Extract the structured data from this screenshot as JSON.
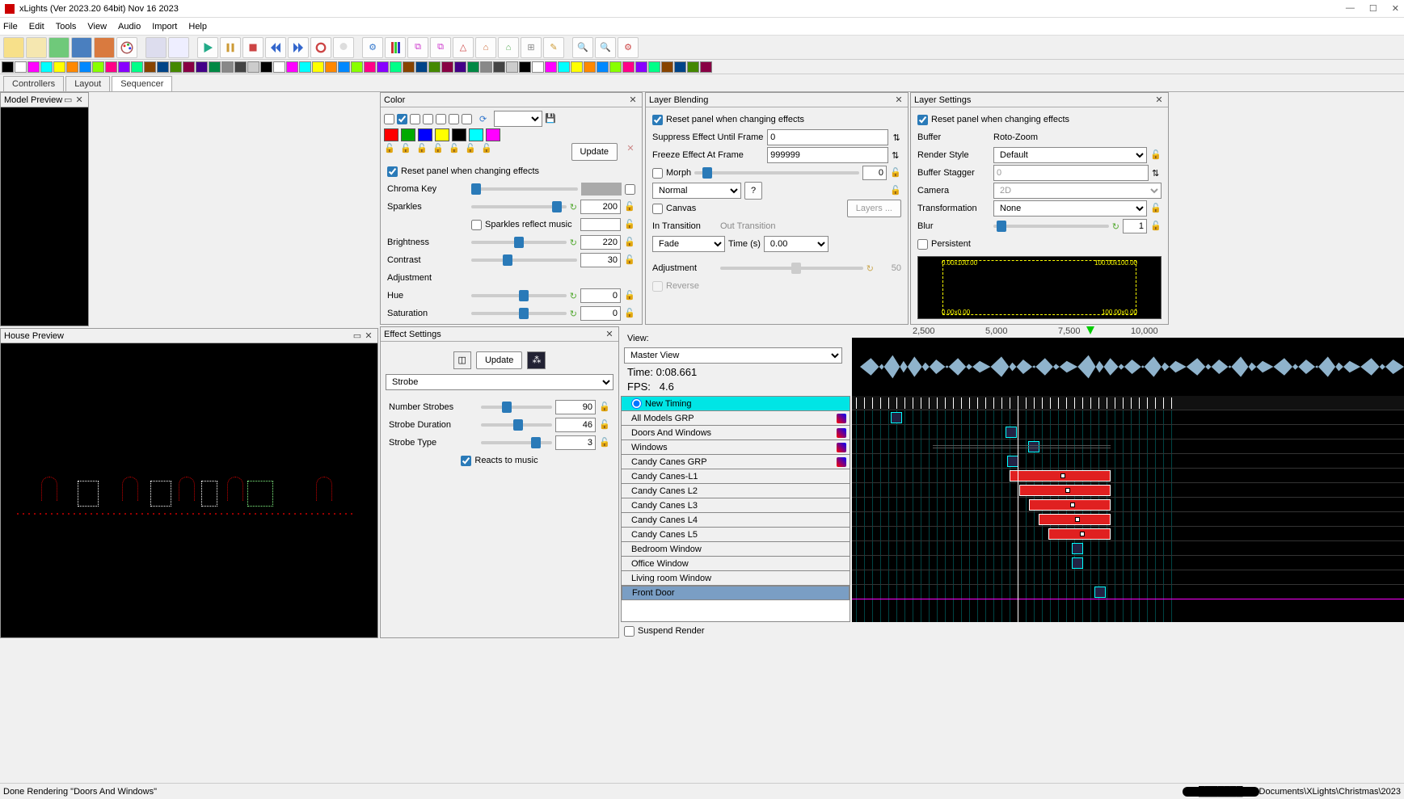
{
  "window": {
    "title": "xLights (Ver 2023.20 64bit) Nov 16 2023"
  },
  "menu": [
    "File",
    "Edit",
    "Tools",
    "View",
    "Audio",
    "Import",
    "Help"
  ],
  "tabs": {
    "items": [
      "Controllers",
      "Layout",
      "Sequencer"
    ],
    "active": 2
  },
  "panels": {
    "model_preview": "Model Preview",
    "house_preview": "House Preview",
    "color": "Color",
    "effect_settings": "Effect Settings",
    "layer_blending": "Layer Blending",
    "layer_settings": "Layer Settings"
  },
  "color": {
    "reset_label": "Reset panel when changing effects",
    "update_btn": "Update",
    "chroma_key": "Chroma Key",
    "sparkles": {
      "label": "Sparkles",
      "value": "200"
    },
    "sparkles_reflect": "Sparkles reflect music",
    "brightness": {
      "label": "Brightness",
      "value": "220"
    },
    "contrast": {
      "label": "Contrast",
      "value": "30"
    },
    "adjustment": "Adjustment",
    "hue": {
      "label": "Hue",
      "value": "0"
    },
    "saturation": {
      "label": "Saturation",
      "value": "0"
    },
    "swatches": [
      "#ff0000",
      "#00aa00",
      "#0000ff",
      "#ffff00",
      "#000000",
      "#00ffff",
      "#ff00ff"
    ]
  },
  "effect": {
    "update": "Update",
    "type": "Strobe",
    "num_strobes": {
      "label": "Number Strobes",
      "value": "90"
    },
    "duration": {
      "label": "Strobe Duration",
      "value": "46"
    },
    "stype": {
      "label": "Strobe Type",
      "value": "3"
    },
    "reacts": "Reacts to music"
  },
  "blend": {
    "reset": "Reset panel when changing effects",
    "suppress": {
      "label": "Suppress Effect Until Frame",
      "value": "0"
    },
    "freeze": {
      "label": "Freeze Effect At Frame",
      "value": "999999"
    },
    "morph": "Morph",
    "morph_val": "0",
    "mode": "Normal",
    "q": "?",
    "canvas": "Canvas",
    "layers_btn": "Layers ...",
    "in_t": "In Transition",
    "out_t": "Out Transition",
    "fade": "Fade",
    "time_s": "Time (s)",
    "time_val": "0.00",
    "adj": "Adjustment",
    "adj_val": "50",
    "reverse": "Reverse"
  },
  "layer": {
    "reset": "Reset panel when changing effects",
    "buffer": {
      "label": "Buffer",
      "value": "Roto-Zoom"
    },
    "render": {
      "label": "Render Style",
      "value": "Default"
    },
    "stagger": {
      "label": "Buffer Stagger",
      "value": "0"
    },
    "camera": {
      "label": "Camera",
      "value": "2D"
    },
    "transform": {
      "label": "Transformation",
      "value": "None"
    },
    "blur": {
      "label": "Blur",
      "value": "1"
    },
    "persistent": "Persistent",
    "box": {
      "tl": "0.00x100.00",
      "tr": "100.00x100.00",
      "bl": "0.00x0.00",
      "br": "100.00x0.00"
    }
  },
  "seq": {
    "view_lbl": "View:",
    "view": "Master View",
    "time": "Time: 0:08.661",
    "fps": "FPS:   4.6",
    "ruler": [
      "2,500",
      "5,000",
      "7,500",
      "10,000"
    ],
    "rows": [
      {
        "name": "New Timing",
        "timing": true
      },
      {
        "name": "All Models GRP"
      },
      {
        "name": "Doors And Windows"
      },
      {
        "name": "Windows"
      },
      {
        "name": "Candy Canes GRP"
      },
      {
        "name": "Candy Canes-L1"
      },
      {
        "name": "Candy Canes L2"
      },
      {
        "name": "Candy Canes L3"
      },
      {
        "name": "Candy Canes L4"
      },
      {
        "name": "Candy Canes L5"
      },
      {
        "name": "Bedroom Window"
      },
      {
        "name": "Office Window"
      },
      {
        "name": "Living room Window"
      },
      {
        "name": "Front Door",
        "sel": true
      }
    ],
    "suspend": "Suspend Render"
  },
  "status": {
    "left": "Done Rendering \"Doors And Windows\"",
    "right": "Documents\\XLights\\Christmas\\2023"
  }
}
